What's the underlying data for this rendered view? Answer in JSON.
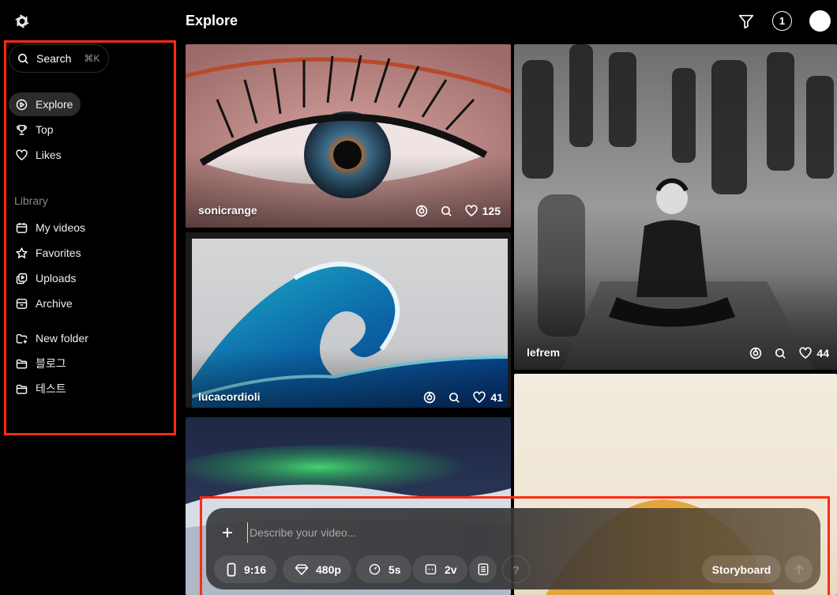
{
  "header": {
    "title": "Explore",
    "notification_count": "1"
  },
  "search": {
    "label": "Search",
    "shortcut": "⌘K"
  },
  "nav": {
    "primary": [
      {
        "label": "Explore",
        "icon": "play-circle-icon",
        "active": true
      },
      {
        "label": "Top",
        "icon": "trophy-icon"
      },
      {
        "label": "Likes",
        "icon": "heart-icon"
      }
    ],
    "library_heading": "Library",
    "library": [
      {
        "label": "My videos",
        "icon": "calendar-icon"
      },
      {
        "label": "Favorites",
        "icon": "star-icon"
      },
      {
        "label": "Uploads",
        "icon": "upload-icon"
      },
      {
        "label": "Archive",
        "icon": "archive-icon"
      }
    ],
    "folders": [
      {
        "label": "New folder",
        "icon": "folder-plus-icon"
      },
      {
        "label": "블로그",
        "icon": "folder-icon"
      },
      {
        "label": "테스트",
        "icon": "folder-icon"
      }
    ]
  },
  "feed": [
    {
      "user": "sonicrange",
      "likes": "125"
    },
    {
      "user": "lefrem",
      "likes": "44"
    },
    {
      "user": "lucacordioli",
      "likes": "41"
    }
  ],
  "composer": {
    "placeholder": "Describe your video...",
    "aspect": "9:16",
    "resolution": "480p",
    "duration": "5s",
    "variations": "2v",
    "help": "?",
    "storyboard": "Storyboard"
  },
  "colors": {
    "highlight_box": "#ff2a12",
    "active_nav": "#2b2b2b"
  }
}
